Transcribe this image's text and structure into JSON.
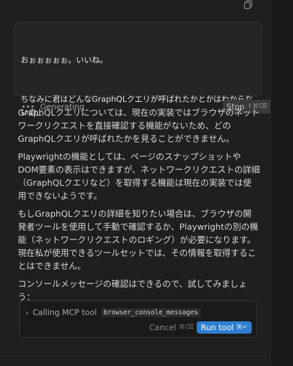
{
  "composer": {
    "line1": "おぉぉぉぉぉ。いいね。",
    "line2": "ちなみに君はどんなGraphQLクエリが呼ばれたかとかはわからないの",
    "line3": "_"
  },
  "status": {
    "generating_label": "Generating",
    "stop_label": "Stop",
    "stop_shortcut": "⇧⌘⌫"
  },
  "message": {
    "paragraphs": [
      "GraphQLクエリについては、現在の実装ではブラウザのネットワークリクエストを直接確認する機能がないため、どのGraphQLクエリが呼ばれたかを見ることができません。",
      "Playwrightの機能としては、ページのスナップショットやDOM要素の表示はできますが、ネットワークリクエストの詳細（GraphQLクエリなど）を取得する機能は現在の実装では使用できないようです。",
      "もしGraphQLクエリの詳細を知りたい場合は、ブラウザの開発者ツールを使用して手動で確認するか、Playwrightの別の機能（ネットワークリクエストのロギング）が必要になります。現在私が使用できるツールセットでは、その情報を取得することはできません。",
      "コンソールメッセージの確認はできるので、試してみましょう："
    ]
  },
  "tool_call": {
    "label": "Calling MCP tool",
    "tool_name": "browser_console_messages",
    "cancel_label": "Cancel",
    "cancel_shortcut": "⌘⌫",
    "run_label": "Run tool",
    "run_shortcut": "⌘↵"
  },
  "icons": {
    "copy": "copy-icon",
    "chevron": "chevron-right-icon",
    "generating": "ellipsis-icon"
  },
  "colors": {
    "background": "#1f1f1f",
    "run_button": "#2f7fd0",
    "stop_button": "#3a3a3a"
  }
}
